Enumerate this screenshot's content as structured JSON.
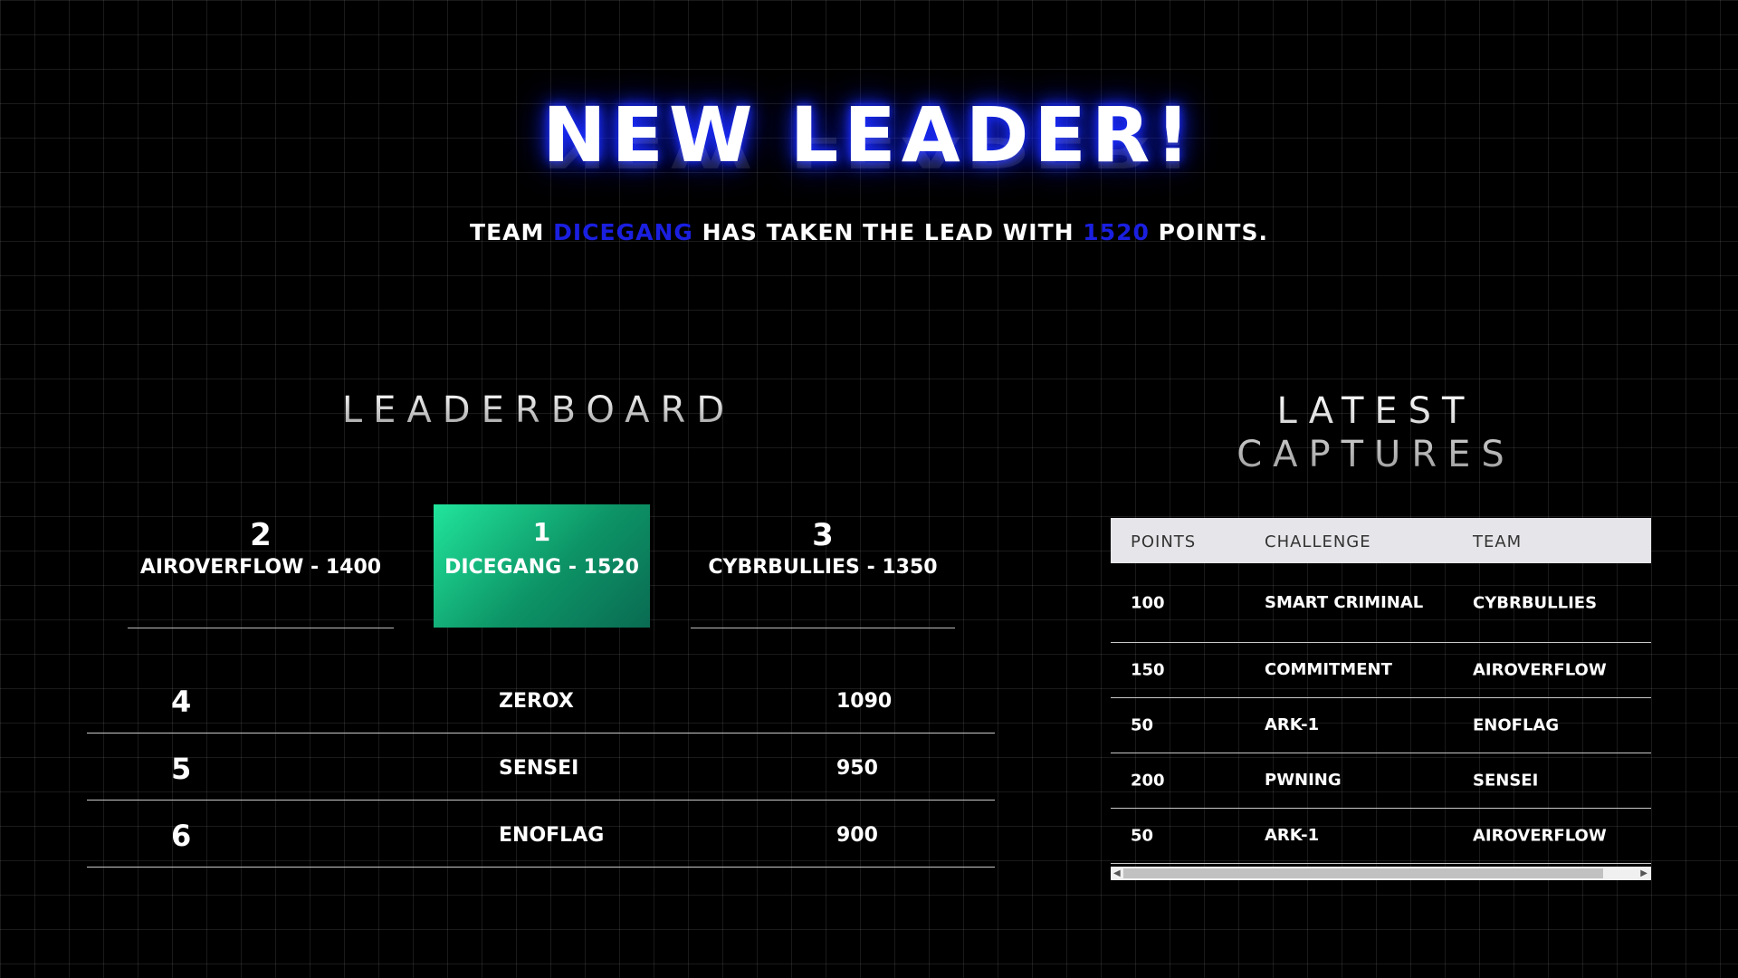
{
  "headline": "NEW LEADER!",
  "subline": {
    "prefix": "TEAM",
    "team": "DICEGANG",
    "middle": "HAS TAKEN THE LEAD WITH",
    "points": "1520",
    "suffix": "POINTS."
  },
  "leaderboard": {
    "title": "LEADERBOARD",
    "podium": [
      {
        "rank": "2",
        "name": "AIROVERFLOW - 1400"
      },
      {
        "rank": "1",
        "name": "DICEGANG - 1520"
      },
      {
        "rank": "3",
        "name": "CYBRBULLIES - 1350"
      }
    ],
    "rows": [
      {
        "rank": "4",
        "name": "ZEROX",
        "score": "1090"
      },
      {
        "rank": "5",
        "name": "SENSEI",
        "score": "950"
      },
      {
        "rank": "6",
        "name": "ENOFLAG",
        "score": "900"
      }
    ]
  },
  "captures": {
    "title_line1": "LATEST",
    "title_line2": "CAPTURES",
    "headers": [
      "POINTS",
      "CHALLENGE",
      "TEAM"
    ],
    "rows": [
      {
        "points": "100",
        "challenge": "SMART CRIMINAL",
        "team": "CYBRBULLIES"
      },
      {
        "points": "150",
        "challenge": "COMMITMENT",
        "team": "AIROVERFLOW"
      },
      {
        "points": "50",
        "challenge": "ARK-1",
        "team": "ENOFLAG"
      },
      {
        "points": "200",
        "challenge": "PWNING",
        "team": "SENSEI"
      },
      {
        "points": "50",
        "challenge": "ARK-1",
        "team": "AIROVERFLOW"
      }
    ]
  },
  "colors": {
    "accent_blue": "#1a1fe0",
    "leader_green": "#21e59c"
  }
}
